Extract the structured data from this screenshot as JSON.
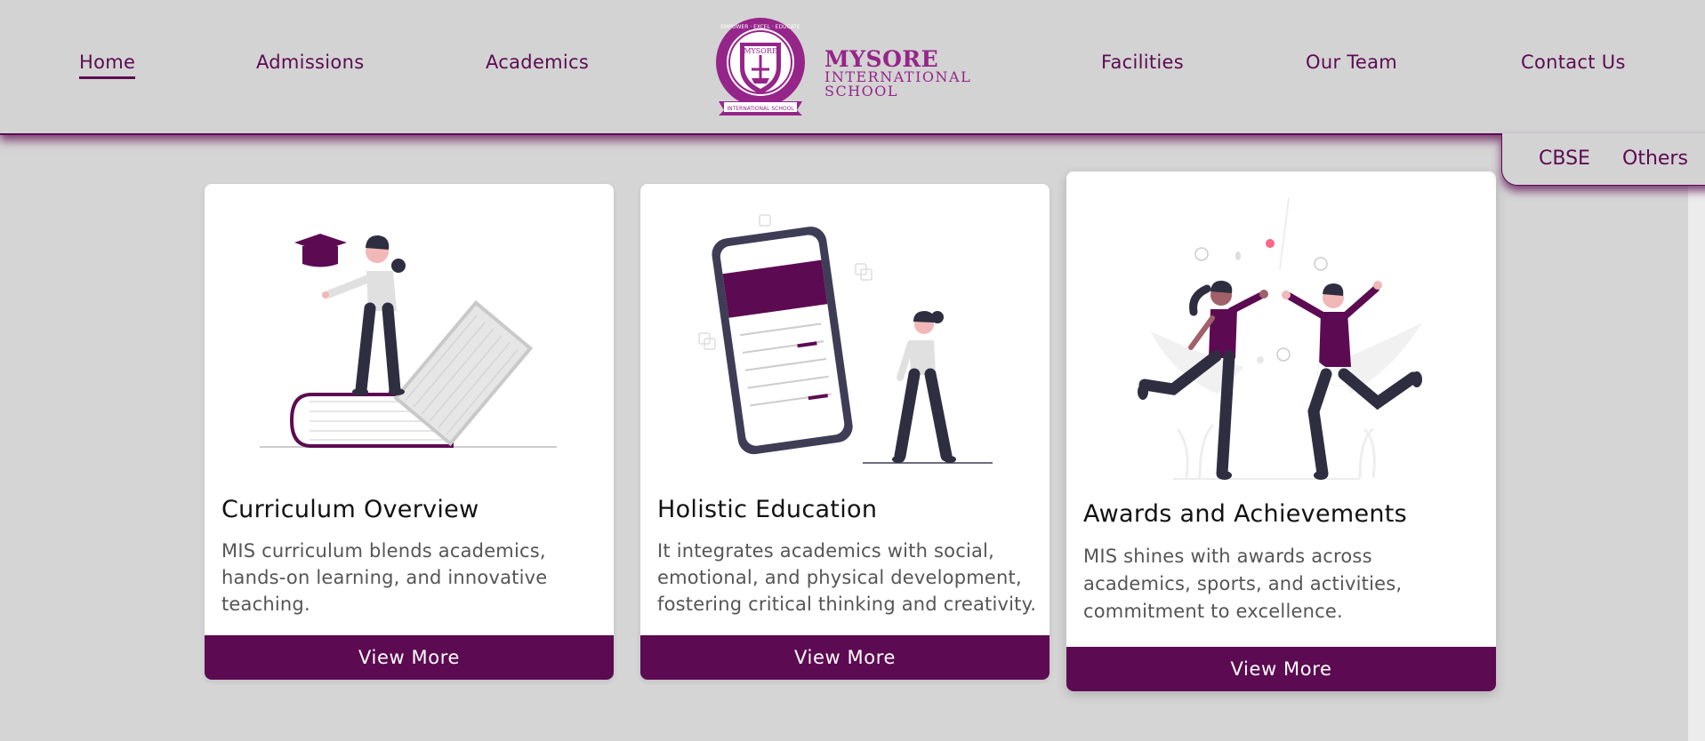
{
  "nav": {
    "home": "Home",
    "admissions": "Admissions",
    "academics": "Academics",
    "facilities": "Facilities",
    "our_team": "Our Team",
    "contact_us": "Contact Us"
  },
  "logo": {
    "line1": "MYSORE",
    "line2": "INTERNATIONAL",
    "line3": "SCHOOL",
    "emblem_top": "EMPOWER · EXCEL · EDUCATE",
    "emblem_center": "MYSORE",
    "emblem_bottom": "INTERNATIONAL SCHOOL"
  },
  "dropdown": {
    "item1": "CBSE",
    "item2": "Others"
  },
  "cards": [
    {
      "title": "Curriculum Overview",
      "desc_lines": [
        "MIS curriculum blends academics,",
        "hands-on learning, and innovative",
        "teaching."
      ],
      "button": "View More"
    },
    {
      "title": "Holistic Education",
      "desc_lines": [
        "It integrates academics with social,",
        "emotional, and physical development,",
        "fostering critical thinking and creativity."
      ],
      "button": "View More"
    },
    {
      "title": "Awards and Achievements",
      "desc_lines": [
        "MIS shines with awards across",
        "academics, sports, and activities,",
        "commitment to excellence."
      ],
      "button": "View More"
    }
  ],
  "colors": {
    "brand": "#5c0b52",
    "logo": "#96258a",
    "background": "#d5d5d5",
    "navbar": "#d3d3d3"
  },
  "icons": [
    "school-emblem-icon",
    "curriculum-illustration",
    "holistic-illustration",
    "awards-illustration"
  ]
}
